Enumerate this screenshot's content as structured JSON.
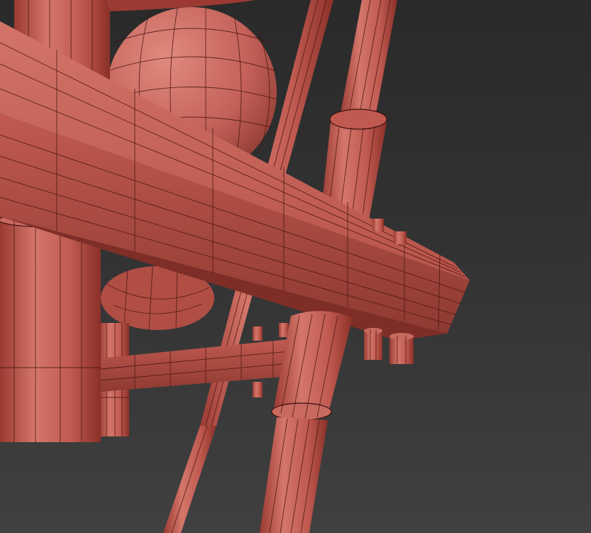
{
  "scene": {
    "kind": "3d-viewport-wireframe-render",
    "background": {
      "top": "#2a2a2a",
      "bottom": "#404040"
    },
    "material": {
      "base": "#c0524a",
      "light": "#d8756a",
      "dark": "#8a3028",
      "wire": "#4a1410"
    },
    "objects": [
      "main-beam",
      "lower-beam",
      "sphere",
      "upper-cylinder",
      "left-cylinder",
      "small-left-cylinder",
      "thin-rod",
      "right-leg",
      "front-leg",
      "bolts"
    ]
  }
}
